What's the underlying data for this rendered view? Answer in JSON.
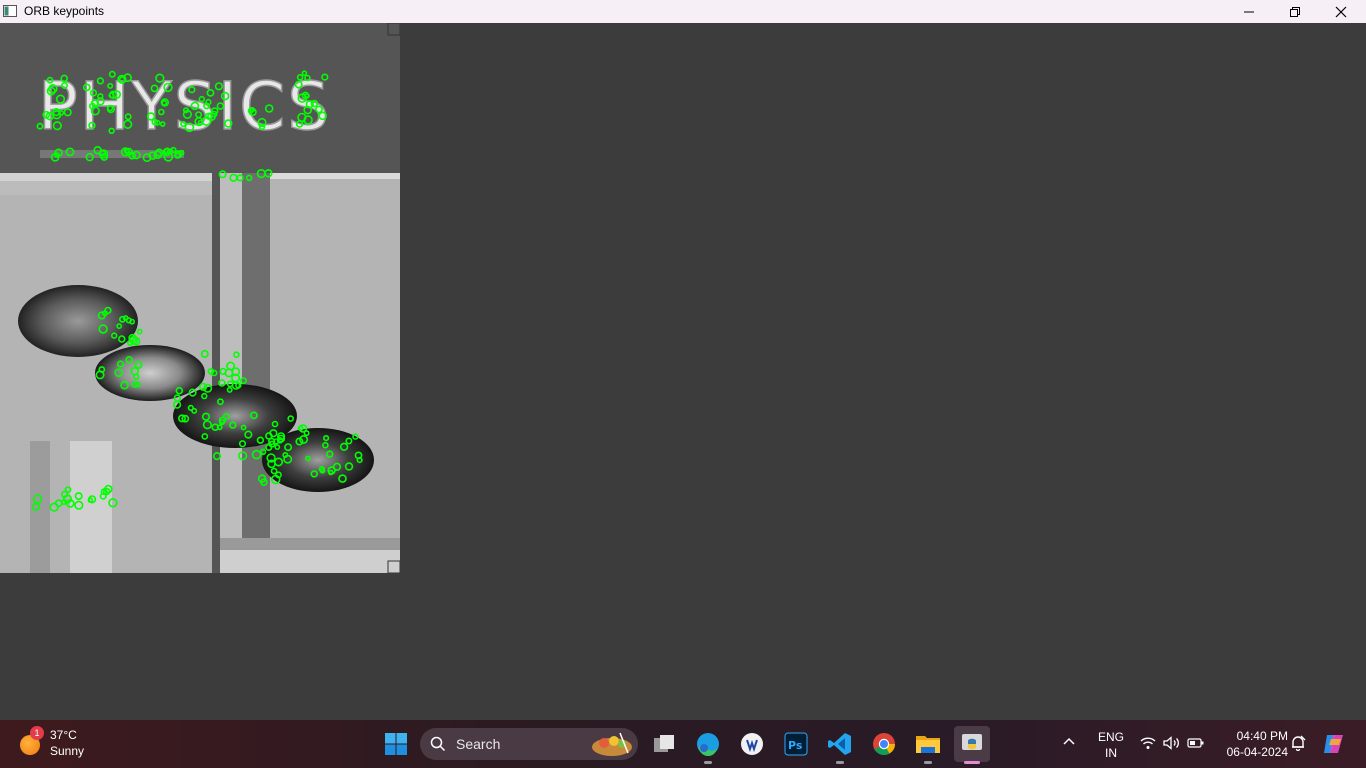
{
  "window": {
    "title": "ORB keypoints"
  },
  "image": {
    "heading": "PHYSICS",
    "keypoint_color": "#00ff00"
  },
  "taskbar": {
    "weather": {
      "temperature": "37°C",
      "condition": "Sunny",
      "badge": "1"
    },
    "search": {
      "placeholder": "Search"
    },
    "apps": [
      {
        "name": "task-view"
      },
      {
        "name": "edge"
      },
      {
        "name": "word-pad"
      },
      {
        "name": "photoshop",
        "label": "Ps"
      },
      {
        "name": "vscode"
      },
      {
        "name": "chrome"
      },
      {
        "name": "file-explorer"
      },
      {
        "name": "python"
      }
    ],
    "language": {
      "line1": "ENG",
      "line2": "IN"
    },
    "clock": {
      "time": "04:40 PM",
      "date": "06-04-2024"
    },
    "colors": {
      "active_indicator": "#e38ad2"
    }
  }
}
